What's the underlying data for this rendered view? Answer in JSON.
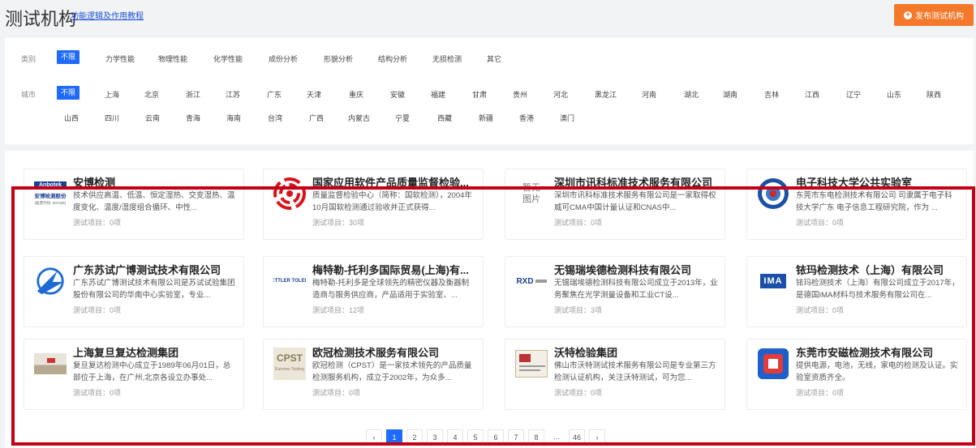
{
  "header": {
    "title": "测试机构",
    "tutorial_link": "功能逻辑及作用教程",
    "publish_button": "发布测试机构"
  },
  "filters": {
    "category_label": "类别",
    "categories": [
      "不限",
      "力学性能",
      "物理性能",
      "化学性能",
      "成份分析",
      "形貌分析",
      "结构分析",
      "无损检测",
      "其它"
    ],
    "city_label": "城市",
    "cities_row1": [
      "不限",
      "上海",
      "北京",
      "浙江",
      "江苏",
      "广东",
      "天津",
      "重庆",
      "安徽",
      "福建",
      "甘肃",
      "贵州",
      "河北",
      "黑龙江",
      "河南",
      "湖北",
      "湖南",
      "吉林",
      "江西",
      "辽宁",
      "山东",
      "陕西"
    ],
    "cities_row2": [
      "山西",
      "四川",
      "云南",
      "青海",
      "海南",
      "台湾",
      "广西",
      "内蒙古",
      "宁夏",
      "西藏",
      "新疆",
      "香港",
      "澳门"
    ]
  },
  "cards": [
    {
      "name": "安博检测",
      "desc": "技术供应高温、低温、恒定湿热、交变湿热、温度变化、温度/湿度组合循环、中性...",
      "count": "测试项目：0项",
      "logo": "anbo-logo"
    },
    {
      "name": "国家应用软件产品质量监督检验...",
      "desc": "质量监督检验中心（简称：国软检测），2004年10月国软检测通过验收并正式获得...",
      "count": "测试项目：30项",
      "logo": "red-swirl-logo"
    },
    {
      "name": "深圳市讯科标准技术服务有限公司",
      "desc": "深圳市讯科标准技术服务有限公司是一家取得权威可CMA中国计量认证和CNAS中...",
      "count": "测试项目：0项",
      "logo": "no-image"
    },
    {
      "name": "电子科技大学公共实验室",
      "desc": "东莞市东电检测技术有限公司 司隶属于电子科技大学广东 电子信息工程研究院，作为 ...",
      "count": "测试项目：0项",
      "logo": "uestc-seal"
    },
    {
      "name": "广东苏试广博测试技术有限公司",
      "desc": "广东苏试广博测试技术有限公司是苏试试验集团股份有限公司的华南中心实验室，专业...",
      "count": "测试项目：0项",
      "logo": "blue-swoosh-logo"
    },
    {
      "name": "梅特勒-托利多国际贸易(上海)有...",
      "desc": "梅特勒-托利多是全球领先的精密仪器及衡器制造商与服务供应商，产品适用于实验室、...",
      "count": "测试项目：12项",
      "logo": "mettler-logo"
    },
    {
      "name": "无锡瑞埃德检测科技有限公司",
      "desc": "无锡瑞埃德检测科技有限公司成立于2013年，业务聚焦在光学测量设备和工业CT设...",
      "count": "测试项目：3项",
      "logo": "rxd-logo"
    },
    {
      "name": "铱玛检测技术（上海）有限公司",
      "desc": "铱玛检测技术（上海）有限公司成立于2017年，是德国IMA材料与技术服务有限公司在...",
      "count": "测试项目：0项",
      "logo": "ima-logo"
    },
    {
      "name": "上海复旦复达检测集团",
      "desc": "复旦复达检测中心成立于1989年06月01日，总部位于上海，在广州,北京各设立办事处...",
      "count": "测试项目：0项",
      "logo": "office-photo"
    },
    {
      "name": "欧冠检测技术服务有限公司",
      "desc": "欧冠检测（CPST）是一家技术领先的产品质量检测服务机构，成立于2002年，为众多...",
      "count": "测试项目：0项",
      "logo": "cpst-logo"
    },
    {
      "name": "沃特检验集团",
      "desc": "佛山市沃特测试技术服务有限公司是专业第三方检测认证机构，关注沃特测试，可为您...",
      "count": "测试项目：0项",
      "logo": "certificate-photo"
    },
    {
      "name": "东莞市安磁检测技术有限公司",
      "desc": "提供电源，电池，无线，家电的检测及认证。实验室资质齐全。",
      "count": "测试项目：0项",
      "logo": "anci-logo"
    }
  ],
  "no_image_text": [
    "暂无",
    "图片"
  ],
  "logo_text": {
    "anbo_top": "Anbotek",
    "anbo_mid": "安博检测股份",
    "anbo_bot": "(股票代码: 837435)",
    "mettler": "METTLER TOLEDO",
    "rxd": "RXD",
    "ima": "IMA",
    "cpst": "CPST",
    "cpst_sub": "Eurones Testing"
  },
  "pagination": {
    "prev": "‹",
    "pages": [
      "1",
      "2",
      "3",
      "4",
      "5",
      "6",
      "7",
      "8"
    ],
    "ellipsis": "...",
    "last": "46",
    "next": "›",
    "active": "1"
  },
  "colors": {
    "accent_blue": "#1f6bff",
    "publish_orange": "#f4792b",
    "highlight_red": "#c40016"
  }
}
